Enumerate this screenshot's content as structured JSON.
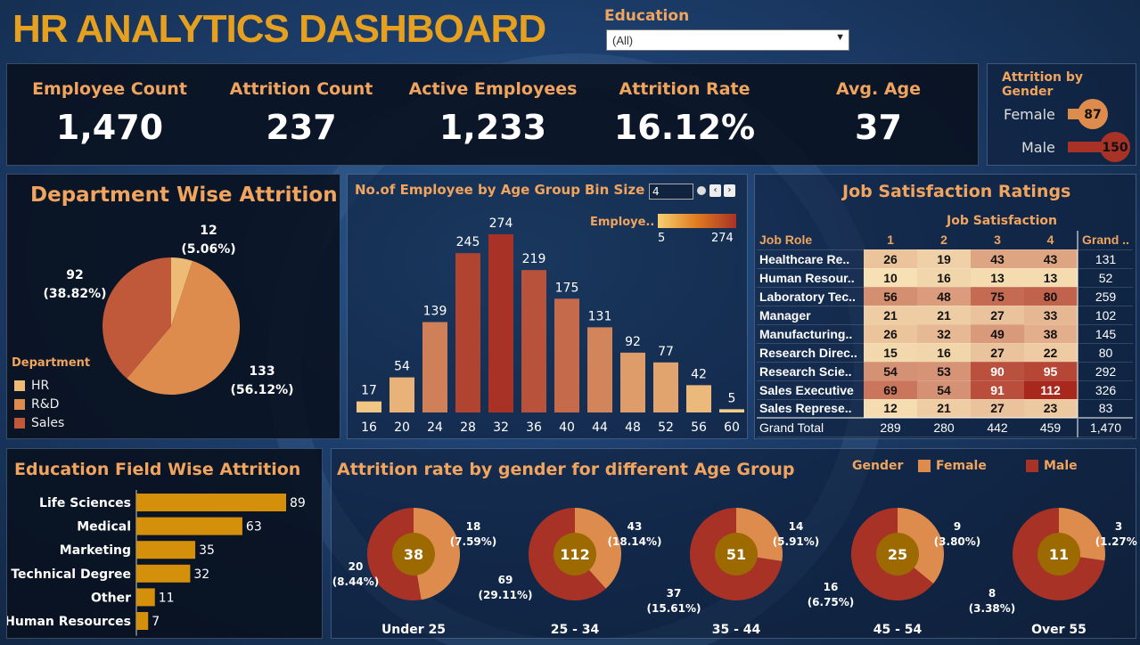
{
  "header": {
    "title": "HR ANALYTICS DASHBOARD"
  },
  "filter": {
    "label": "Education",
    "value": "(All)"
  },
  "kpis": [
    {
      "label": "Employee Count",
      "value": "1,470"
    },
    {
      "label": "Attrition Count",
      "value": "237"
    },
    {
      "label": "Active Employees",
      "value": "1,233"
    },
    {
      "label": "Attrition Rate",
      "value": "16.12%"
    },
    {
      "label": "Avg. Age",
      "value": "37"
    }
  ],
  "gender_panel": {
    "title": "Attrition by Gender",
    "rows": [
      {
        "label": "Female",
        "value": "87"
      },
      {
        "label": "Male",
        "value": "150"
      }
    ]
  },
  "dept_panel": {
    "title": "Department Wise Attrition",
    "legend_title": "Department",
    "legend": [
      "HR",
      "R&D",
      "Sales"
    ],
    "labels": [
      {
        "v": "12",
        "p": "(5.06%)"
      },
      {
        "v": "133",
        "p": "(56.12%)"
      },
      {
        "v": "92",
        "p": "(38.82%)"
      }
    ]
  },
  "age_panel": {
    "title": "No.of Employee by Age Group",
    "bin_label": "Bin Size",
    "bin_value": "4",
    "legend_label": "Employe..",
    "legend_min": "5",
    "legend_max": "274"
  },
  "job_panel": {
    "title": "Job Satisfaction Ratings",
    "subheader": "Job Satisfaction",
    "col_role": "Job Role",
    "cols": [
      "1",
      "2",
      "3",
      "4"
    ],
    "col_total": "Grand ..",
    "total_label": "Grand Total",
    "rows": [
      {
        "role": "Healthcare Re..",
        "vals": [
          "26",
          "19",
          "43",
          "43"
        ],
        "total": "131"
      },
      {
        "role": "Human Resour..",
        "vals": [
          "10",
          "16",
          "13",
          "13"
        ],
        "total": "52"
      },
      {
        "role": "Laboratory Tec..",
        "vals": [
          "56",
          "48",
          "75",
          "80"
        ],
        "total": "259"
      },
      {
        "role": "Manager",
        "vals": [
          "21",
          "21",
          "27",
          "33"
        ],
        "total": "102"
      },
      {
        "role": "Manufacturing..",
        "vals": [
          "26",
          "32",
          "49",
          "38"
        ],
        "total": "145"
      },
      {
        "role": "Research Direc..",
        "vals": [
          "15",
          "16",
          "27",
          "22"
        ],
        "total": "80"
      },
      {
        "role": "Research Scie..",
        "vals": [
          "54",
          "53",
          "90",
          "95"
        ],
        "total": "292"
      },
      {
        "role": "Sales Executive",
        "vals": [
          "69",
          "54",
          "91",
          "112"
        ],
        "total": "326"
      },
      {
        "role": "Sales Represe..",
        "vals": [
          "12",
          "21",
          "27",
          "23"
        ],
        "total": "83"
      }
    ],
    "totals": {
      "vals": [
        "289",
        "280",
        "442",
        "459"
      ],
      "total": "1,470"
    }
  },
  "edu_panel": {
    "title": "Education Field Wise Attrition"
  },
  "donut_panel": {
    "title": "Attrition rate by gender for different Age Group",
    "legend_title": "Gender",
    "legend": [
      "Female",
      "Male"
    ],
    "groups": [
      {
        "name": "Under 25",
        "center": "38",
        "f": "18",
        "fp": "(7.59%)",
        "m": "20",
        "mp": "(8.44%)"
      },
      {
        "name": "25 - 34",
        "center": "112",
        "f": "43",
        "fp": "(18.14%)",
        "m": "69",
        "mp": "(29.11%)"
      },
      {
        "name": "35 - 44",
        "center": "51",
        "f": "14",
        "fp": "(5.91%)",
        "m": "37",
        "mp": "(15.61%)"
      },
      {
        "name": "45 - 54",
        "center": "25",
        "f": "9",
        "fp": "(3.80%)",
        "m": "16",
        "mp": "(6.75%)"
      },
      {
        "name": "Over 55",
        "center": "11",
        "f": "3",
        "fp": "(1.27%)",
        "m": "8",
        "mp": "(3.38%)"
      }
    ]
  },
  "colors": {
    "female": "#dd8c4e",
    "male": "#a93226",
    "gold": "#d4900a",
    "accent": "#f0a45e",
    "hr": "#eebb77",
    "rd": "#dd8c4e",
    "sales": "#c0583a"
  },
  "chart_data": [
    {
      "type": "bar",
      "title": "No.of Employee by Age Group",
      "categories": [
        "16",
        "20",
        "24",
        "28",
        "32",
        "36",
        "40",
        "44",
        "48",
        "52",
        "56",
        "60"
      ],
      "values": [
        17,
        54,
        139,
        245,
        274,
        219,
        175,
        131,
        92,
        77,
        42,
        5
      ]
    },
    {
      "type": "pie",
      "title": "Department Wise Attrition",
      "categories": [
        "HR",
        "R&D",
        "Sales"
      ],
      "values": [
        12,
        133,
        92
      ]
    },
    {
      "type": "bar",
      "title": "Education Field Wise Attrition",
      "categories": [
        "Life Sciences",
        "Medical",
        "Marketing",
        "Technical Degree",
        "Other",
        "Human Resources"
      ],
      "values": [
        89,
        63,
        35,
        32,
        11,
        7
      ]
    },
    {
      "type": "pie",
      "title": "Attrition rate by gender for different Age Group",
      "categories": [
        "Under 25",
        "25 - 34",
        "35 - 44",
        "45 - 54",
        "Over 55"
      ],
      "series": [
        {
          "name": "Female",
          "values": [
            18,
            43,
            14,
            9,
            3
          ]
        },
        {
          "name": "Male",
          "values": [
            20,
            69,
            37,
            16,
            8
          ]
        }
      ]
    },
    {
      "type": "bar",
      "title": "Attrition by Gender",
      "categories": [
        "Female",
        "Male"
      ],
      "values": [
        87,
        150
      ]
    }
  ]
}
